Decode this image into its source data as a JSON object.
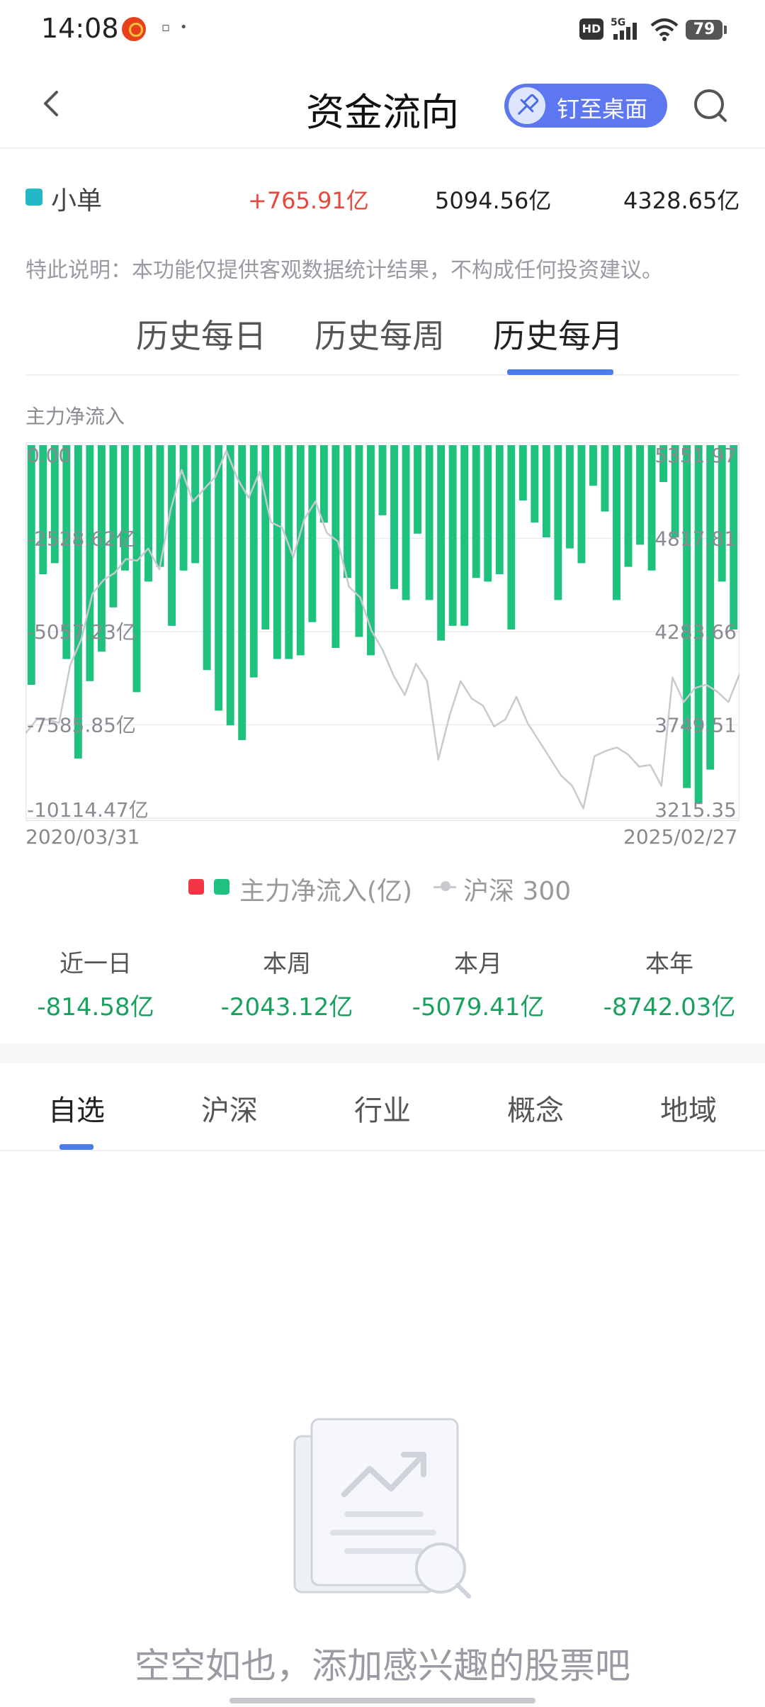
{
  "status_bar": {
    "time": "14:08",
    "hd": "HD",
    "network": "5G",
    "battery": "79",
    "icons": [
      "app-notification-icon",
      "more-notifications-icon",
      "signal-icon",
      "wifi-icon",
      "battery-icon"
    ]
  },
  "navbar": {
    "title": "资金流向",
    "pin_label": "钉至桌面",
    "icons": [
      "back-icon",
      "pin-icon",
      "search-icon"
    ]
  },
  "legend_row": {
    "name": "小单",
    "net": "+765.91亿",
    "inflow": "5094.56亿",
    "outflow": "4328.65亿",
    "color": "#21b8c7",
    "net_color": "#e8473c"
  },
  "disclaimer": "特此说明：本功能仅提供客观数据统计结果，不构成任何投资建议。",
  "period_tabs": [
    "历史每日",
    "历史每周",
    "历史每月"
  ],
  "period_active": 2,
  "chart_data": {
    "type": "bar",
    "title": "主力净流入",
    "y_left_ticks": [
      "0.00",
      "-2528.62亿",
      "-5057.23亿",
      "-7585.85亿",
      "-10114.47亿"
    ],
    "y_right_ticks": [
      "5351.97",
      "4817.81",
      "4283.66",
      "3749.51",
      "3215.35"
    ],
    "ylim": [
      -10114.47,
      0
    ],
    "y2lim": [
      3215.35,
      5351.97
    ],
    "x_start": "2020/03/31",
    "x_end": "2025/02/27",
    "legend_label": "主力净流入(亿)",
    "line_label": "沪深 300",
    "positive_color": "#f23645",
    "negative_color": "#1ec17e",
    "line_color": "#c9c9d0",
    "grid": true,
    "series": [
      {
        "name": "主力净流入(亿)",
        "values": [
          -6500,
          -3500,
          -3200,
          -5800,
          -8500,
          -6400,
          -5600,
          -4400,
          -3400,
          -6700,
          -3700,
          -3300,
          -4900,
          -3400,
          -3200,
          -6100,
          -7200,
          -7600,
          -8000,
          -6300,
          -5000,
          -5800,
          -5800,
          -5700,
          -4800,
          -2100,
          -5500,
          -3600,
          -5200,
          -5700,
          -1900,
          -3900,
          -4200,
          -2400,
          -4200,
          -5300,
          -4900,
          -4900,
          -3600,
          -3700,
          -3500,
          -5000,
          -1500,
          -2100,
          -2500,
          -4200,
          -2800,
          -3200,
          -1100,
          -1800,
          -4200,
          -3300,
          -2700,
          -3400,
          -1000,
          -2500,
          -9300,
          -9700,
          -8800,
          -3700,
          -5000
        ]
      },
      {
        "name": "沪深 300",
        "values": [
          3700,
          3780,
          3780,
          3760,
          4090,
          4240,
          4500,
          4580,
          4620,
          4700,
          4690,
          4760,
          4640,
          4980,
          5210,
          5030,
          5100,
          5170,
          5320,
          5160,
          5050,
          5200,
          4910,
          4880,
          4710,
          4930,
          5030,
          4850,
          4800,
          4540,
          4480,
          4290,
          4180,
          4030,
          3920,
          4100,
          4000,
          3550,
          3800,
          4000,
          3900,
          3860,
          3740,
          3780,
          3910,
          3760,
          3660,
          3560,
          3460,
          3400,
          3270,
          3570,
          3600,
          3620,
          3580,
          3510,
          3520,
          3400,
          4020,
          3880,
          3960,
          3980,
          3940,
          3880,
          4040
        ]
      }
    ]
  },
  "stats": [
    {
      "label": "近一日",
      "value": "-814.58亿"
    },
    {
      "label": "本周",
      "value": "-2043.12亿"
    },
    {
      "label": "本月",
      "value": "-5079.41亿"
    },
    {
      "label": "本年",
      "value": "-8742.03亿"
    }
  ],
  "category_tabs": [
    "自选",
    "沪深",
    "行业",
    "概念",
    "地域"
  ],
  "category_active": 0,
  "empty_state": {
    "text": "空空如也，添加感兴趣的股票吧",
    "icon": "empty-document-chart-icon"
  }
}
